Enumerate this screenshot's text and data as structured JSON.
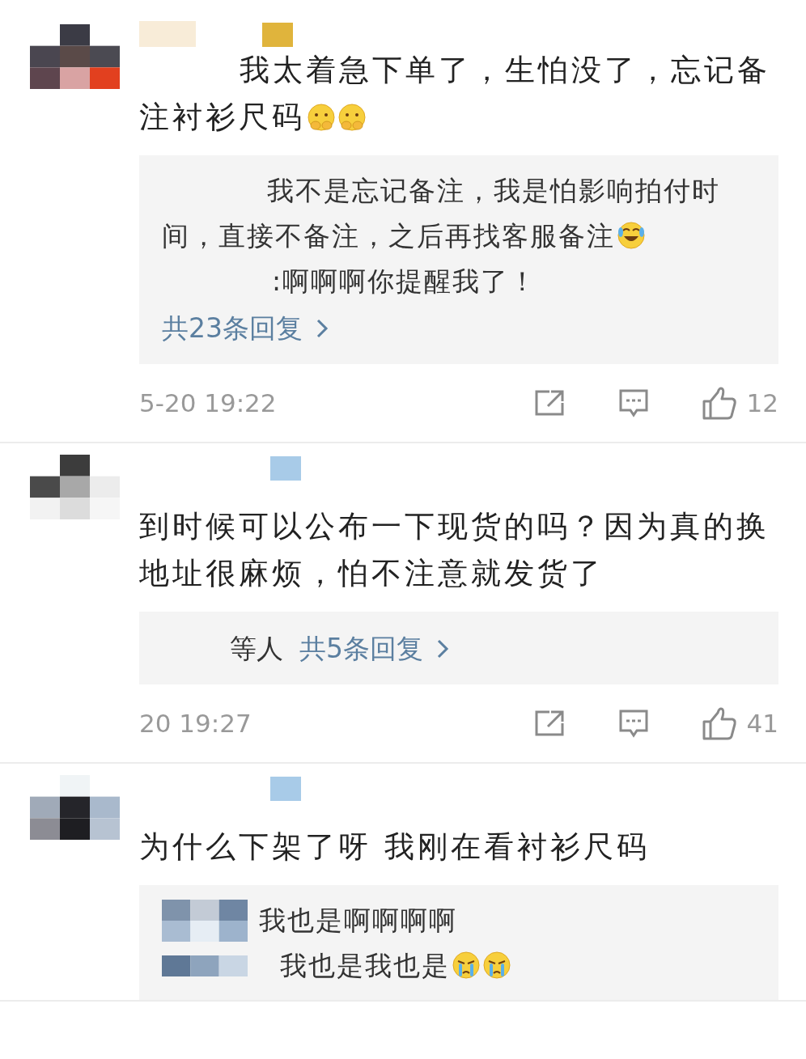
{
  "comments": [
    {
      "text": "我太着急下单了，生怕没了，忘记备注衬衫尺码",
      "emojis": [
        {
          "kind": "shy"
        },
        {
          "kind": "shy"
        }
      ],
      "replies": [
        {
          "text": "我不是忘记备注，我是怕影响拍付时间，直接不备注，之后再找客服备注",
          "emojis": [
            {
              "kind": "laughing"
            }
          ]
        },
        {
          "text": ":啊啊啊你提醒我了！"
        }
      ],
      "more_replies": "共23条回复",
      "time": "5-20 19:22",
      "likes": "12"
    },
    {
      "text": "到时候可以公布一下现货的吗？因为真的换地址很麻烦，怕不注意就发货了",
      "reply_prefix": "等人",
      "more_replies": "共5条回复",
      "time": "20 19:27",
      "likes": "41"
    },
    {
      "text": "为什么下架了呀 我刚在看衬衫尺码",
      "replies": [
        {
          "text": "我也是啊啊啊啊"
        },
        {
          "text": "我也是我也是",
          "emojis": [
            {
              "kind": "crying"
            },
            {
              "kind": "crying"
            }
          ]
        }
      ]
    }
  ]
}
